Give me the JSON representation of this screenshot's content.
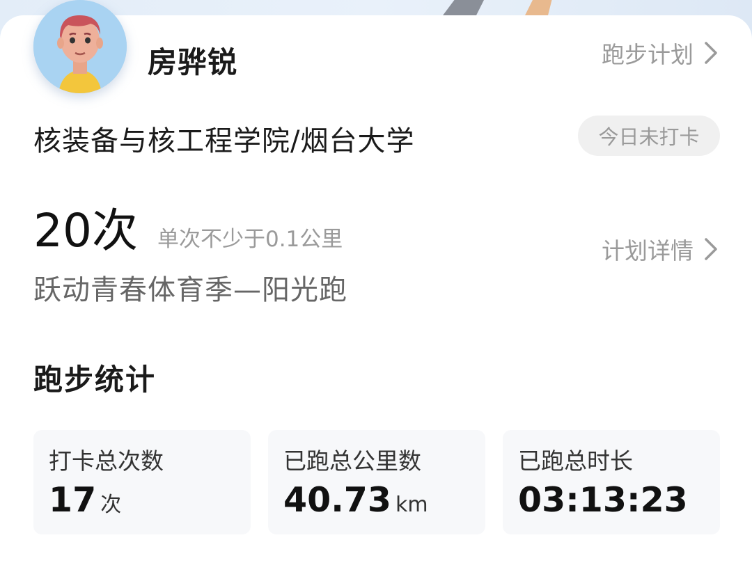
{
  "user": {
    "name": "房骅锐",
    "college": "核装备与核工程学院/烟台大学",
    "checkin_status": "今日未打卡"
  },
  "header": {
    "plan_link": "跑步计划"
  },
  "plan": {
    "count": "20次",
    "requirement": "单次不少于0.1公里",
    "name": "跃动青春体育季—阳光跑",
    "detail_link": "计划详情"
  },
  "stats": {
    "title": "跑步统计",
    "items": [
      {
        "label": "打卡总次数",
        "value": "17",
        "unit": "次"
      },
      {
        "label": "已跑总公里数",
        "value": "40.73",
        "unit": "km"
      },
      {
        "label": "已跑总时长",
        "value": "03:13:23",
        "unit": ""
      }
    ]
  },
  "icons": {
    "avatar": "cartoon-avatar",
    "chevron": "chevron-right-icon"
  },
  "colors": {
    "background": "#dce9f7",
    "card": "#ffffff",
    "muted_text": "#9a9a9a",
    "badge_bg": "#f0f0f0",
    "stat_bg": "#f7f8fa"
  }
}
